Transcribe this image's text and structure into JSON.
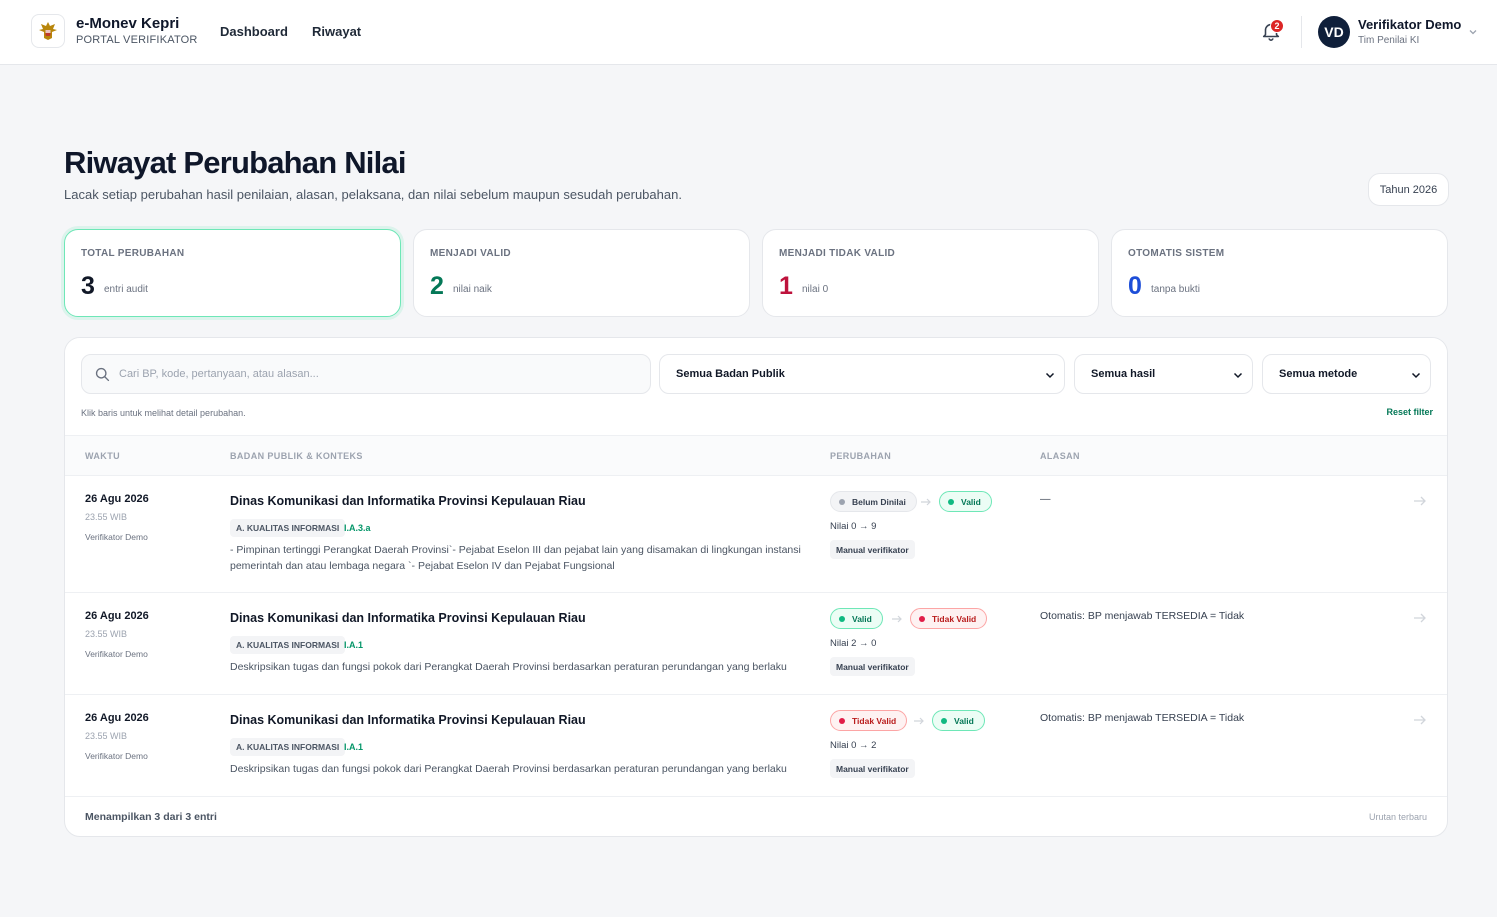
{
  "brand": {
    "name": "e-Monev Kepri",
    "subtitle": "PORTAL VERIFIKATOR"
  },
  "nav": [
    {
      "label": "Dashboard"
    },
    {
      "label": "Riwayat"
    }
  ],
  "notifications": {
    "count": "2"
  },
  "user": {
    "initials": "VD",
    "name": "Verifikator Demo",
    "role": "Tim Penilai KI"
  },
  "page": {
    "title": "Riwayat Perubahan Nilai",
    "subtitle": "Lacak setiap perubahan hasil penilaian, alasan, pelaksana, dan nilai sebelum maupun sesudah perubahan.",
    "year_button": "Tahun 2026"
  },
  "stats": [
    {
      "label": "TOTAL PERUBAHAN",
      "value": "3",
      "note": "entri audit",
      "color": "#111827"
    },
    {
      "label": "MENJADI VALID",
      "value": "2",
      "note": "nilai naik",
      "color": "#047857"
    },
    {
      "label": "MENJADI TIDAK VALID",
      "value": "1",
      "note": "nilai 0",
      "color": "#be123c"
    },
    {
      "label": "OTOMATIS SISTEM",
      "value": "0",
      "note": "tanpa bukti",
      "color": "#1d4ed8"
    }
  ],
  "filters": {
    "search_placeholder": "Cari BP, kode, pertanyaan, atau alasan...",
    "badan_publik": "Semua Badan Publik",
    "hasil": "Semua hasil",
    "metode": "Semua metode",
    "hint": "Klik baris untuk melihat detail perubahan.",
    "reset": "Reset filter"
  },
  "table": {
    "headers": [
      "WAKTU",
      "BADAN PUBLIK & KONTEKS",
      "PERUBAHAN",
      "ALASAN"
    ],
    "rows": [
      {
        "date": "26 Agu 2026",
        "time": "23.55 WIB",
        "by": "Verifikator Demo",
        "org": "Dinas Komunikasi dan Informatika Provinsi Kepulauan Riau",
        "category": "A. KUALITAS INFORMASI",
        "code": "I.A.3.a",
        "desc": "- Pimpinan tertinggi Perangkat Daerah Provinsi`- Pejabat Eselon III dan pejabat lain yang disamakan di lingkungan instansi pemerintah dan atau lembaga negara `- Pejabat Eselon IV dan Pejabat Fungsional",
        "from": "Belum Dinilai",
        "to": "Valid",
        "nilai": "Nilai 0 → 9",
        "method": "Manual verifikator",
        "reason": "—"
      },
      {
        "date": "26 Agu 2026",
        "time": "23.55 WIB",
        "by": "Verifikator Demo",
        "org": "Dinas Komunikasi dan Informatika Provinsi Kepulauan Riau",
        "category": "A. KUALITAS INFORMASI",
        "code": "I.A.1",
        "desc": "Deskripsikan tugas dan fungsi pokok dari Perangkat Daerah Provinsi berdasarkan peraturan perundangan yang berlaku",
        "from": "Valid",
        "to": "Tidak Valid",
        "nilai": "Nilai 2 → 0",
        "method": "Manual verifikator",
        "reason": "Otomatis: BP menjawab TERSEDIA = Tidak"
      },
      {
        "date": "26 Agu 2026",
        "time": "23.55 WIB",
        "by": "Verifikator Demo",
        "org": "Dinas Komunikasi dan Informatika Provinsi Kepulauan Riau",
        "category": "A. KUALITAS INFORMASI",
        "code": "I.A.1",
        "desc": "Deskripsikan tugas dan fungsi pokok dari Perangkat Daerah Provinsi berdasarkan peraturan perundangan yang berlaku",
        "from": "Tidak Valid",
        "to": "Valid",
        "nilai": "Nilai 0 → 2",
        "method": "Manual verifikator",
        "reason": "Otomatis: BP menjawab TERSEDIA = Tidak"
      }
    ]
  },
  "footer": {
    "count": "Menampilkan 3 dari 3 entri",
    "sort": "Urutan terbaru"
  }
}
